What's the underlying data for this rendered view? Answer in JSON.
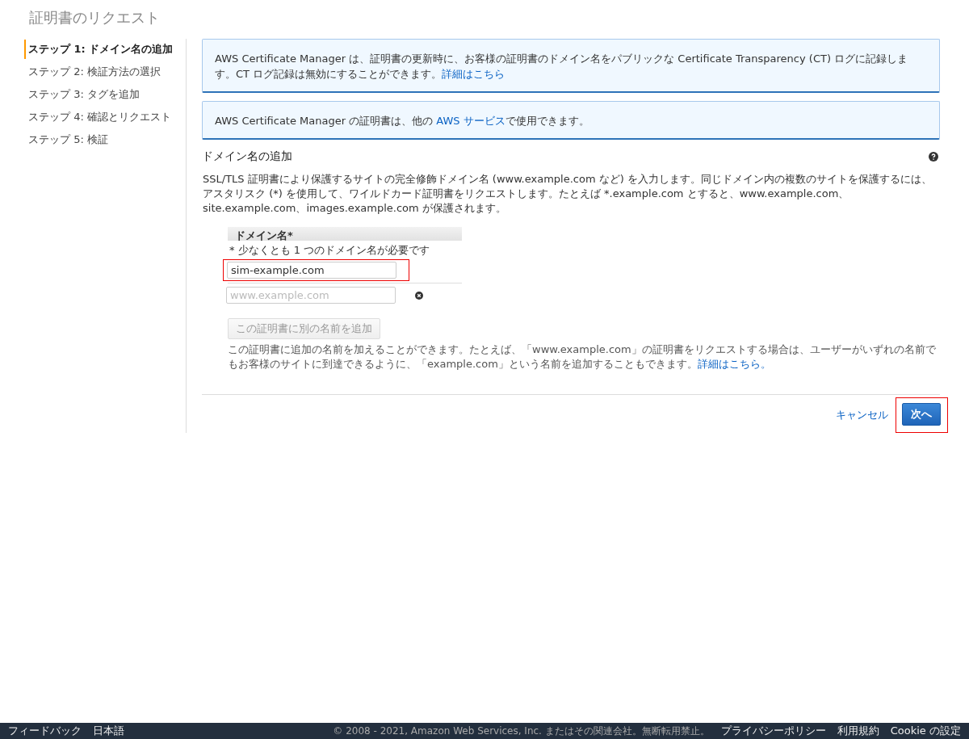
{
  "page_title": "証明書のリクエスト",
  "steps": [
    {
      "label": "ステップ 1: ドメイン名の追加",
      "selected": true
    },
    {
      "label": "ステップ 2: 検証方法の選択",
      "selected": false
    },
    {
      "label": "ステップ 3: タグを追加",
      "selected": false
    },
    {
      "label": "ステップ 4: 確認とリクエスト",
      "selected": false
    },
    {
      "label": "ステップ 5: 検証",
      "selected": false
    }
  ],
  "notices": [
    {
      "text": "AWS Certificate Manager は、証明書の更新時に、お客様の証明書のドメイン名をパブリックな Certificate Transparency (CT) ログに記録します。CT ログ記録は無効にすることができます。",
      "link": "詳細はこちら"
    },
    {
      "text": "AWS Certificate Manager の証明書は、他の ",
      "link": "AWS サービス",
      "after": "で使用できます。"
    }
  ],
  "section": {
    "title": "ドメイン名の追加",
    "description": "SSL/TLS 証明書により保護するサイトの完全修飾ドメイン名 (www.example.com など) を入力します。同じドメイン内の複数のサイトを保護するには、アスタリスク (*) を使用して、ワイルドカード証明書をリクエストします。たとえば *.example.com とすると、www.example.com、site.example.com、images.example.com が保護されます。"
  },
  "domain_table": {
    "header": "ドメイン名*",
    "hint": "* 少なくとも 1 つのドメイン名が必要です",
    "fields": [
      {
        "value": "sim-example.com",
        "highlighted": true,
        "removable": false
      },
      {
        "placeholder": "www.example.com",
        "highlighted": false,
        "removable": true
      }
    ],
    "add_button": "この証明書に別の名前を追加",
    "note": "この証明書に追加の名前を加えることができます。たとえば、「www.example.com」の証明書をリクエストする場合は、ユーザーがいずれの名前でもお客様のサイトに到達できるように、「example.com」という名前を追加することもできます。",
    "note_link": "詳細はこちら。"
  },
  "actions": {
    "cancel": "キャンセル",
    "next": "次へ",
    "next_highlighted": true
  },
  "footer": {
    "left": [
      "フィードバック",
      "日本語"
    ],
    "copyright": "© 2008 - 2021, Amazon Web Services, Inc. またはその関連会社。無断転用禁止。",
    "links": [
      "プライバシーポリシー",
      "利用規約",
      "Cookie の設定"
    ]
  }
}
